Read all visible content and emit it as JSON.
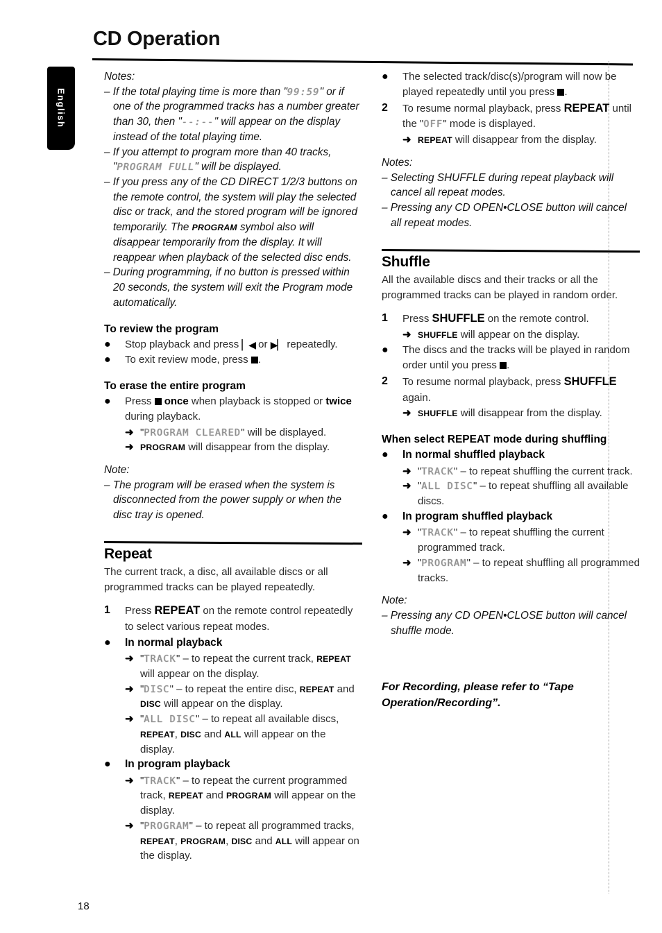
{
  "page": {
    "title": "CD Operation",
    "number": "18",
    "language_tab": "English"
  },
  "glyphs": {
    "bullet": "●",
    "arrow": "➜",
    "stop": "■",
    "prev": "▏◀",
    "next": "▶▏"
  },
  "left_column": {
    "notes_label": "Notes:",
    "note1_a": "– If the total playing time is more than \"",
    "note1_lcd1": "99:59",
    "note1_b": "\" or if one of the programmed tracks has a number greater than 30, then \"",
    "note1_lcd2": "--:--",
    "note1_c": "\" will appear on the display instead of the total playing time.",
    "note2_a": "– If you attempt to program more than 40 tracks, \"",
    "note2_lcd": "PROGRAM FULL",
    "note2_b": "\" will be displayed.",
    "note3": "– If you press any of the CD DIRECT 1/2/3 buttons on the remote control, the system will play the selected disc or track, and the stored program will be ignored temporarily. The",
    "note3_sc": "PROGRAM",
    "note3_b": "symbol also will disappear temporarily from the display. It will reappear when playback of the selected disc ends.",
    "note4": "– During programming, if no button is pressed within 20 seconds, the system will exit the Program mode automatically.",
    "review_heading": "To review the program",
    "review_1_a": "Stop playback and press",
    "review_1_b": "or",
    "review_1_c": "repeatedly.",
    "review_2_a": "To exit review mode, press",
    "review_2_b": ".",
    "erase_heading": "To erase the entire program",
    "erase_1_a": "Press",
    "erase_1_once": "once",
    "erase_1_b": "when playback is stopped or",
    "erase_1_twice": "twice",
    "erase_1_c": "during playback.",
    "erase_arrow1_lcd": "PROGRAM CLEARED",
    "erase_arrow1_a": "\"",
    "erase_arrow1_b": "\" will be displayed.",
    "erase_arrow2_sc": "PROGRAM",
    "erase_arrow2_b": "will disappear from the display.",
    "erase_note_label": "Note:",
    "erase_note_text": "– The program will be erased when the system is disconnected from the power supply or when the disc tray is opened.",
    "repeat_heading": "Repeat",
    "repeat_intro": "The current track, a disc, all available discs or all programmed tracks can be played repeatedly.",
    "repeat_step1_a": "Press",
    "repeat_step1_btn": "REPEAT",
    "repeat_step1_b": "on the remote control repeatedly to select various repeat modes.",
    "normal_playback_heading": "In normal playback",
    "np_a_lcd": "TRACK",
    "np_a_text": "– to repeat the current track,",
    "np_a_sc": "REPEAT",
    "np_a_tail": "will appear on the display.",
    "np_b_lcd": "DISC",
    "np_b_text": "– to repeat the entire disc,",
    "np_b_sc1": "REPEAT",
    "np_b_mid": "and",
    "np_b_sc2": "DISC",
    "np_b_tail": "will appear on the display.",
    "np_c_lcd": "ALL DISC",
    "np_c_text": "– to repeat all available discs,",
    "np_c_sc1": "REPEAT",
    "np_c_sc2": "DISC",
    "np_c_mid": "and",
    "np_c_sc3": "ALL",
    "np_c_tail": "will appear on the display.",
    "program_playback_heading": "In program playback",
    "pp_a_lcd": "TRACK",
    "pp_a_text": "– to repeat the current programmed track,",
    "pp_a_sc1": "REPEAT",
    "pp_a_mid": "and",
    "pp_a_sc2": "PROGRAM",
    "pp_a_tail": "will appear on the display.",
    "pp_b_lcd": "PROGRAM",
    "pp_b_text": "– to repeat all programmed tracks,",
    "pp_b_sc1": "REPEAT",
    "pp_b_sc2": "PROGRAM",
    "pp_b_sc3": "DISC",
    "pp_b_mid": "and",
    "pp_b_sc4": "ALL",
    "pp_b_tail": "will appear on the display."
  },
  "right_column": {
    "rep_b1_a": "The selected track/disc(s)/program will now be played repeatedly until you press",
    "rep_b1_b": ".",
    "rep_step2_a": "To resume normal playback, press",
    "rep_step2_btn": "REPEAT",
    "rep_step2_b": "until the \"",
    "rep_step2_lcd": "OFF",
    "rep_step2_c": "\" mode is displayed.",
    "rep_arrow_sc": "REPEAT",
    "rep_arrow_text": "will disappear from the display.",
    "notes_label": "Notes:",
    "note1": "– Selecting SHUFFLE during repeat playback will cancel all repeat modes.",
    "note2": "– Pressing any CD OPEN•CLOSE button will cancel all repeat modes.",
    "shuffle_heading": "Shuffle",
    "shuffle_intro": "All the available discs and their tracks or all the programmed tracks can be played in random order.",
    "sh_step1_a": "Press",
    "sh_step1_btn": "SHUFFLE",
    "sh_step1_b": "on the remote control.",
    "sh_step1_arrow_sc": "SHUFFLE",
    "sh_step1_arrow_text": "will appear on the display.",
    "sh_bullet_a": "The discs and the tracks will be played in random order until you press",
    "sh_bullet_b": ".",
    "sh_step2_a": "To resume normal playback, press",
    "sh_step2_btn": "SHUFFLE",
    "sh_step2_b": "again.",
    "sh_step2_arrow_sc": "SHUFFLE",
    "sh_step2_arrow_text": "will disappear from the display.",
    "when_heading_a": "When select",
    "when_heading_btn": "REPEAT",
    "when_heading_b": "mode during shuffling",
    "nsp_heading": "In normal shuffled playback",
    "nsp_a_lcd": "TRACK",
    "nsp_a_text": "– to repeat shuffling the current track.",
    "nsp_b_lcd": "ALL DISC",
    "nsp_b_text": "– to repeat shuffling all available discs.",
    "psp_heading": "In program shuffled playback",
    "psp_a_lcd": "TRACK",
    "psp_a_text": "– to repeat shuffling the current programmed track.",
    "psp_b_lcd": "PROGRAM",
    "psp_b_text": "– to repeat shuffling all programmed tracks.",
    "note_label": "Note:",
    "note_text": "– Pressing any CD OPEN•CLOSE button will cancel shuffle mode.",
    "closing": "For Recording, please refer to “Tape Operation/Recording”."
  }
}
